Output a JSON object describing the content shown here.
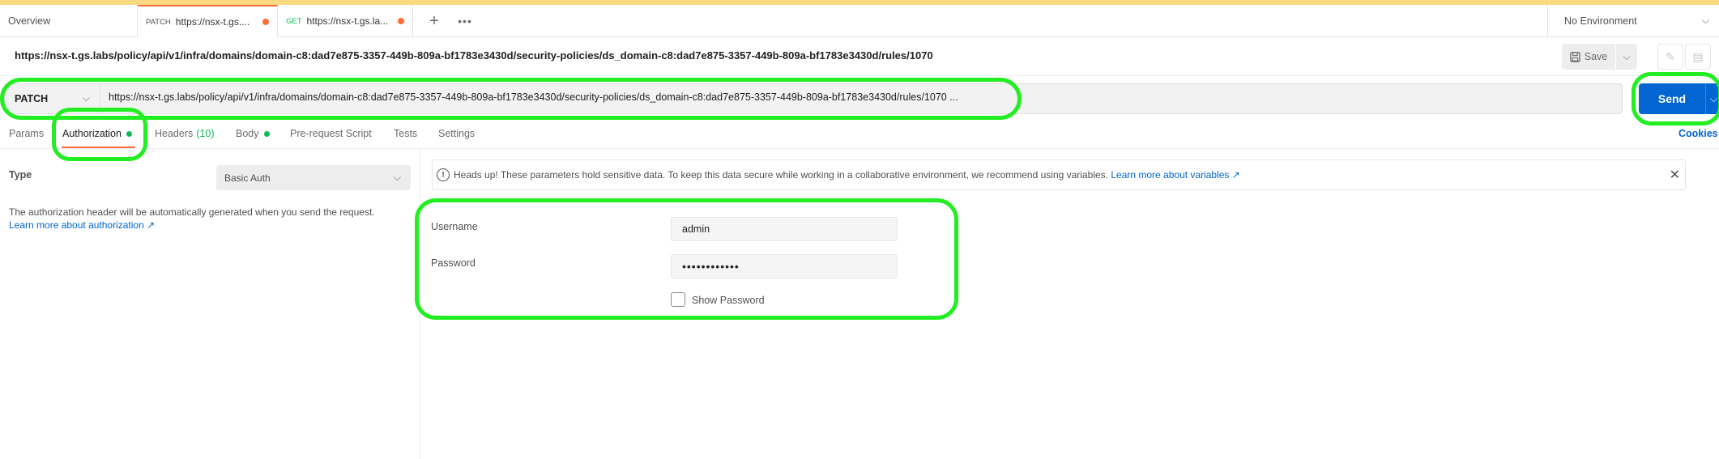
{
  "tabs": {
    "overview_label": "Overview",
    "items": [
      {
        "method": "PATCH",
        "label": "https://nsx-t.gs...."
      },
      {
        "method": "GET",
        "label": "https://nsx-t.gs.la..."
      }
    ],
    "new_tab_icon": "plus-icon",
    "more_icon": "ellipsis-icon"
  },
  "environment": {
    "label": "No Environment"
  },
  "request": {
    "title": "https://nsx-t.gs.labs/policy/api/v1/infra/domains/domain-c8:dad7e875-3357-449b-809a-bf1783e3430d/security-policies/ds_domain-c8:dad7e875-3357-449b-809a-bf1783e3430d/rules/1070",
    "method": "PATCH",
    "url": "https://nsx-t.gs.labs/policy/api/v1/infra/domains/domain-c8:dad7e875-3357-449b-809a-bf1783e3430d/security-policies/ds_domain-c8:dad7e875-3357-449b-809a-bf1783e3430d/rules/1070 ...",
    "save_label": "Save",
    "send_label": "Send"
  },
  "request_tabs": {
    "params": "Params",
    "authorization": "Authorization",
    "headers": "Headers",
    "headers_count": "(10)",
    "body": "Body",
    "pre_request": "Pre-request Script",
    "tests": "Tests",
    "settings": "Settings",
    "cookies": "Cookies"
  },
  "auth": {
    "type_label": "Type",
    "type_value": "Basic Auth",
    "description": "The authorization header will be automatically generated when you send the request.",
    "learn_more": "Learn more about authorization ↗",
    "alert_text": "Heads up! These parameters hold sensitive data. To keep this data secure while working in a collaborative environment, we recommend using variables.",
    "alert_link": "Learn more about variables ↗",
    "username_label": "Username",
    "username_value": "admin",
    "password_label": "Password",
    "password_value": "••••••••••••",
    "show_password_label": "Show Password"
  },
  "colors": {
    "accent": "#ff6c37",
    "send": "#0265d2",
    "highlight": "#22ee22",
    "active_dot": "#0cbb52"
  }
}
